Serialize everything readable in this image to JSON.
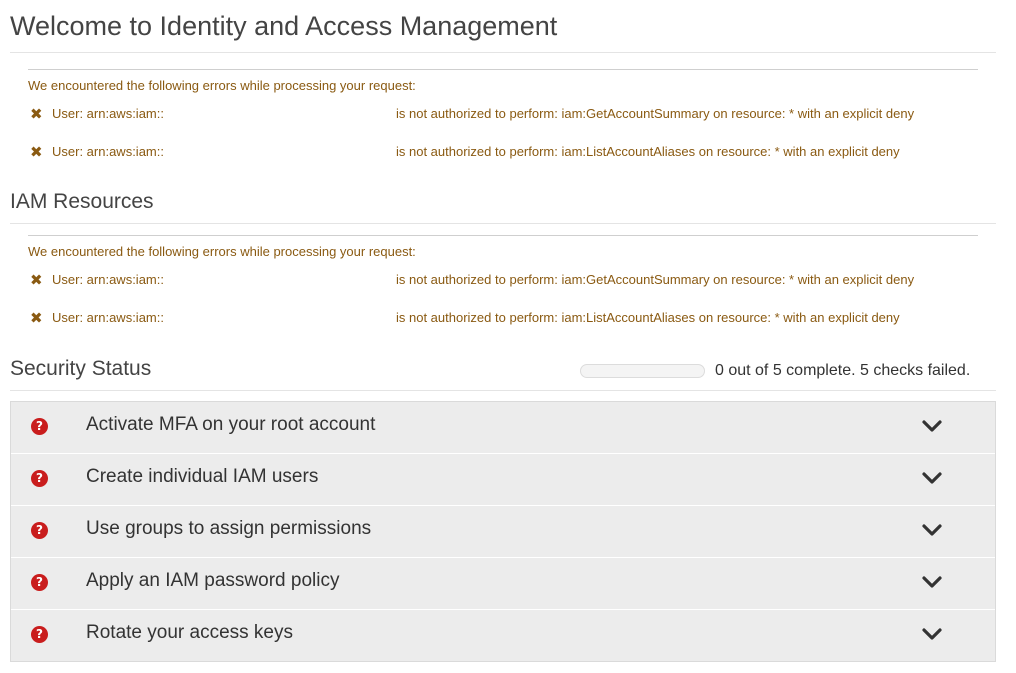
{
  "page_title": "Welcome to Identity and Access Management",
  "sections": [
    {
      "heading": "",
      "errors": {
        "intro": "We encountered the following errors while processing your request:",
        "items": [
          {
            "user": "User: arn:aws:iam::",
            "message": "is not authorized to perform: iam:GetAccountSummary on resource: * with an explicit deny"
          },
          {
            "user": "User: arn:aws:iam::",
            "message": "is not authorized to perform: iam:ListAccountAliases on resource: * with an explicit deny"
          }
        ]
      }
    },
    {
      "heading": "IAM Resources",
      "errors": {
        "intro": "We encountered the following errors while processing your request:",
        "items": [
          {
            "user": "User: arn:aws:iam::",
            "message": "is not authorized to perform: iam:GetAccountSummary on resource: * with an explicit deny"
          },
          {
            "user": "User: arn:aws:iam::",
            "message": "is not authorized to perform: iam:ListAccountAliases on resource: * with an explicit deny"
          }
        ]
      }
    }
  ],
  "security_status": {
    "heading": "Security Status",
    "progress_fraction": 0,
    "summary": "0 out of 5 complete. 5 checks failed.",
    "checks": [
      {
        "label": "Activate MFA on your root account",
        "status": "failed"
      },
      {
        "label": "Create individual IAM users",
        "status": "failed"
      },
      {
        "label": "Use groups to assign permissions",
        "status": "failed"
      },
      {
        "label": "Apply an IAM password policy",
        "status": "failed"
      },
      {
        "label": "Rotate your access keys",
        "status": "failed"
      }
    ]
  },
  "icons": {
    "error": "cross-icon",
    "check_failed": "question-circle-icon",
    "expand": "chevron-down-icon"
  },
  "colors": {
    "error_text": "#8a5a12",
    "failed_icon": "#c91d1d",
    "row_bg": "#ececec"
  }
}
